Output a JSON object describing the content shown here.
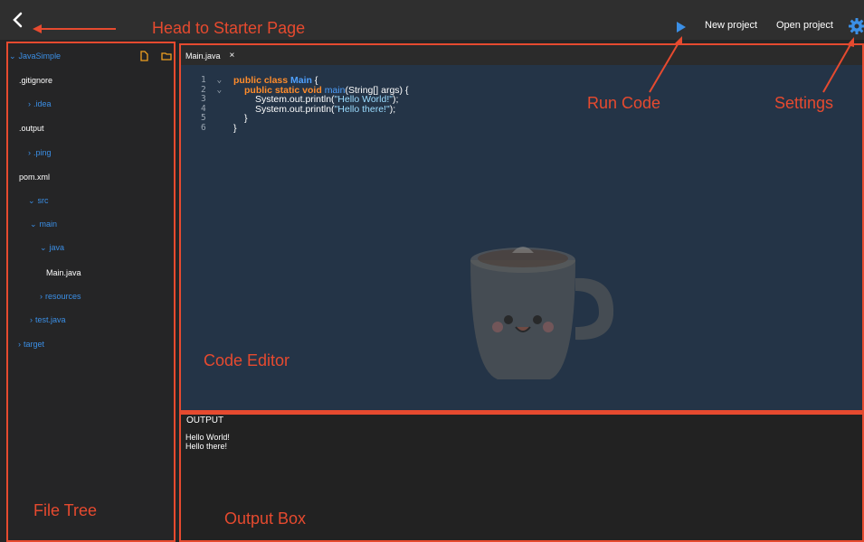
{
  "topbar": {
    "run_icon": "play-icon",
    "new_project_label": "New project",
    "open_project_label": "Open project",
    "settings_icon": "gear-icon",
    "back_icon": "chevron-left-icon"
  },
  "sidebar": {
    "root_label": "JavaSimple",
    "new_file_icon": "file-icon",
    "new_folder_icon": "folder-icon",
    "items": [
      {
        "label": ".gitignore",
        "type": "file"
      },
      {
        "label": ".idea",
        "type": "folder"
      },
      {
        "label": ".output",
        "type": "file"
      },
      {
        "label": ".ping",
        "type": "folder"
      },
      {
        "label": "pom.xml",
        "type": "file"
      },
      {
        "label": "src",
        "type": "folder"
      },
      {
        "label": "main",
        "type": "folder"
      },
      {
        "label": "java",
        "type": "folder"
      },
      {
        "label": "Main.java",
        "type": "file"
      },
      {
        "label": "resources",
        "type": "folder"
      },
      {
        "label": "test.java",
        "type": "folder"
      },
      {
        "label": "target",
        "type": "folder"
      }
    ]
  },
  "editor": {
    "tab_label": "Main.java",
    "tab_close": "×",
    "line_numbers": [
      "1",
      "2",
      "3",
      "4",
      "5",
      "6"
    ],
    "code": {
      "l1_kw": "public class ",
      "l1_cls": "Main",
      "l1_rest": " {",
      "l2_kw": "public static void ",
      "l2_fn": "main",
      "l2_rest": "(String[] args) {",
      "l3_pre": "System.out.println(",
      "l3_str": "\"Hello World!\"",
      "l3_post": ");",
      "l4_pre": "System.out.println(",
      "l4_str": "\"Hello there!\"",
      "l4_post": ");",
      "l5": "}",
      "l6": "}"
    }
  },
  "output": {
    "title": "OUTPUT",
    "lines": [
      "Hello World!",
      "Hello there!"
    ]
  },
  "annotations": {
    "head_to_starter": "Head to Starter Page",
    "run_code": "Run Code",
    "settings": "Settings",
    "code_editor": "Code Editor",
    "file_tree": "File Tree",
    "output_box": "Output Box"
  }
}
